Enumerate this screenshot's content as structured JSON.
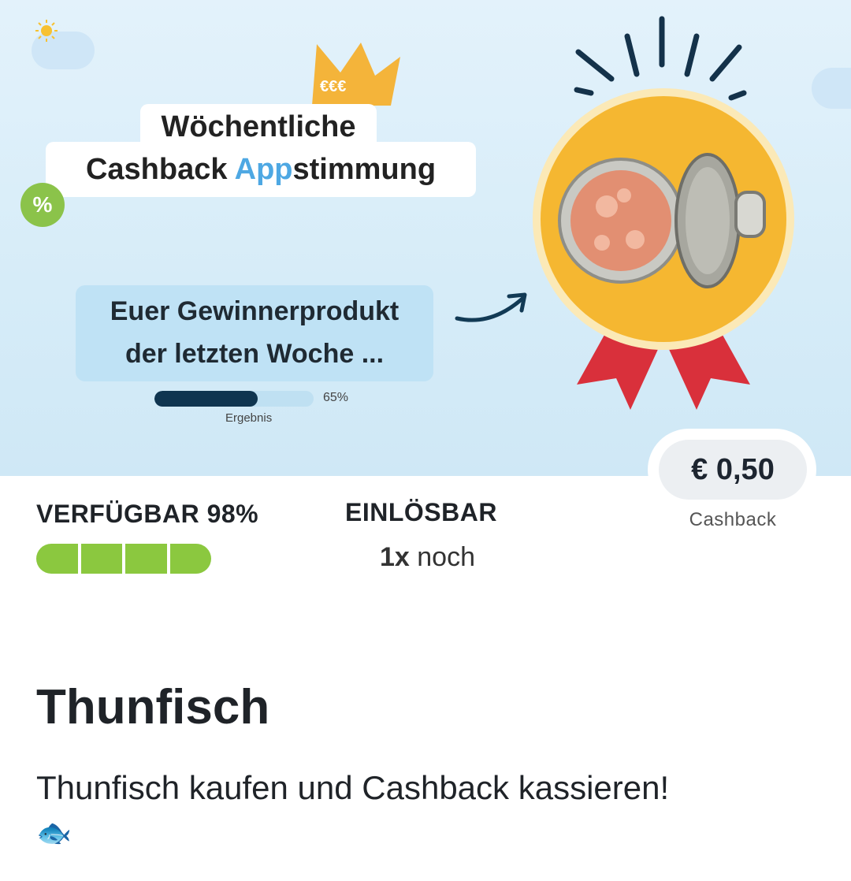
{
  "banner": {
    "title_line1": "Wöchentliche",
    "title_line2_pre": "Cashback ",
    "title_line2_accent": "App",
    "title_line2_post": "stimmung",
    "percent_badge": "%",
    "crown_coins": "€€€",
    "winner_line1": "Euer Gewinnerprodukt",
    "winner_line2": "der letzten Woche ...",
    "result_percent_label": "65%",
    "result_fraction": 0.65,
    "result_label": "Ergebnis"
  },
  "offer": {
    "price": "€ 0,50",
    "price_label": "Cashback",
    "available_label": "VERFÜGBAR 98%",
    "available_fraction": 0.98,
    "redeem_label": "EINLÖSBAR",
    "redeem_count": "1x",
    "redeem_suffix": " noch"
  },
  "product": {
    "title": "Thunfisch",
    "description": "Thunfisch kaufen und Cashback kassieren!",
    "emoji": "🐟"
  },
  "colors": {
    "accent_blue": "#4ea8e3",
    "available_green": "#8bc83f",
    "medal_yellow": "#f5b731",
    "ribbon_red": "#d9303b"
  }
}
